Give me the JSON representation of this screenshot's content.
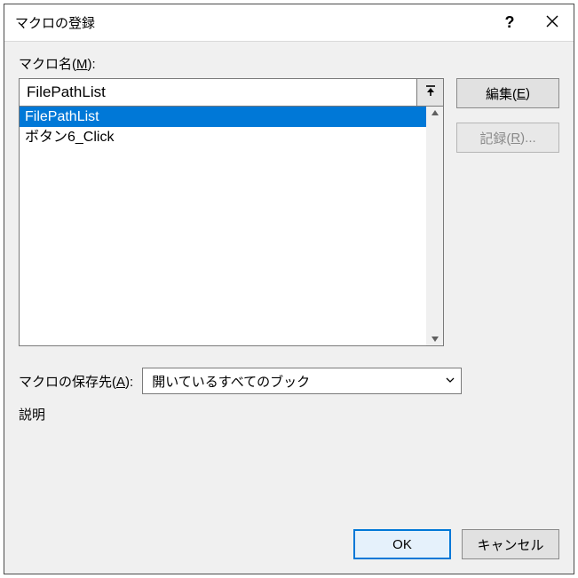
{
  "title": "マクロの登録",
  "macro_name_label_pre": "マクロ名(",
  "macro_name_label_key": "M",
  "macro_name_label_post": "):",
  "macro_name_value": "FilePathList",
  "list_items": [
    "FilePathList",
    "ボタン6_Click"
  ],
  "selected_index": 0,
  "side_buttons": {
    "edit_pre": "編集(",
    "edit_key": "E",
    "edit_post": ")",
    "record_pre": "記録(",
    "record_key": "R",
    "record_post": ")..."
  },
  "location_label_pre": "マクロの保存先(",
  "location_label_key": "A",
  "location_label_post": "):",
  "location_value": "開いているすべてのブック",
  "description_label": "説明",
  "footer": {
    "ok": "OK",
    "cancel": "キャンセル"
  }
}
